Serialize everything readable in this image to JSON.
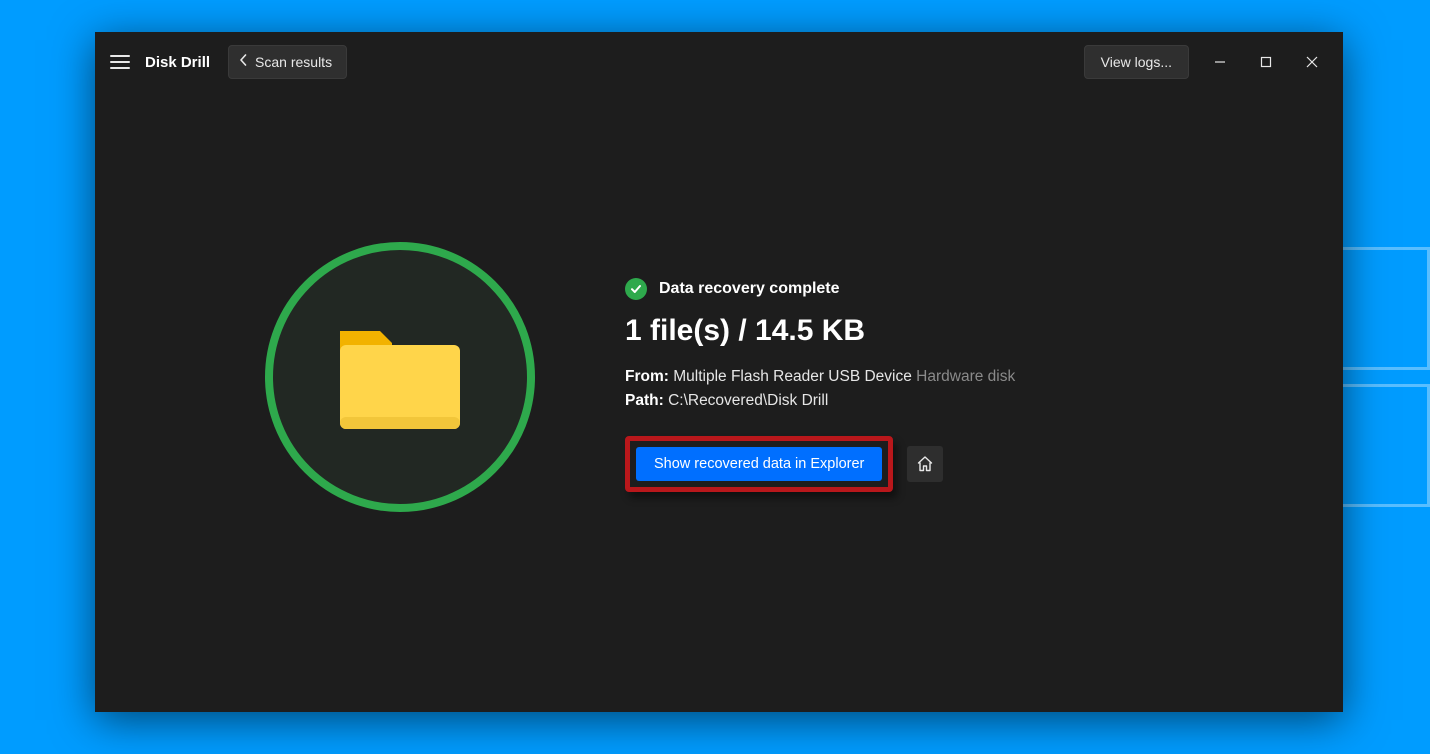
{
  "header": {
    "app_title": "Disk Drill",
    "back_label": "Scan results",
    "view_logs_label": "View logs..."
  },
  "status": {
    "title": "Data recovery complete"
  },
  "result": {
    "headline": "1 file(s) / 14.5 KB",
    "from_label": "From:",
    "from_value": "Multiple Flash Reader USB Device",
    "from_type": "Hardware disk",
    "path_label": "Path:",
    "path_value": "C:\\Recovered\\Disk Drill"
  },
  "actions": {
    "show_label": "Show recovered data in Explorer"
  }
}
